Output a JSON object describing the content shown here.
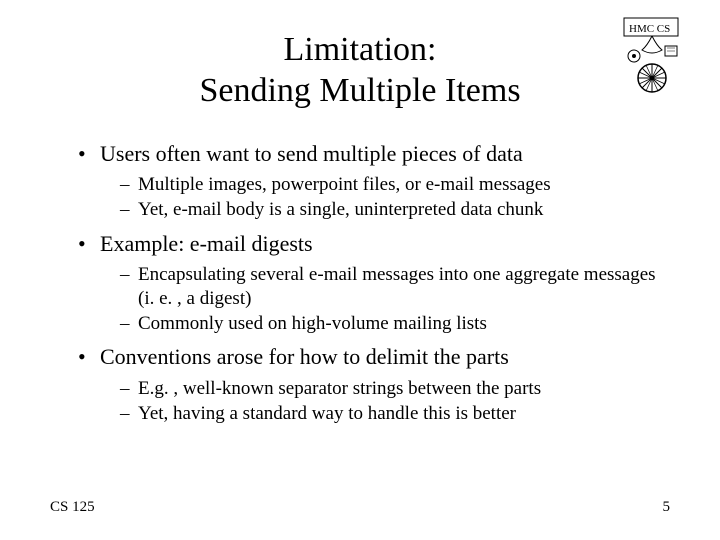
{
  "title_line1": "Limitation:",
  "title_line2": "Sending Multiple Items",
  "bullets": [
    {
      "text": "Users often want to send multiple pieces of data",
      "subs": [
        "Multiple images, powerpoint files, or e-mail messages",
        "Yet, e-mail body is a single, uninterpreted data chunk"
      ]
    },
    {
      "text": "Example: e-mail digests",
      "subs": [
        "Encapsulating several e-mail messages into one aggregate messages (i. e. , a digest)",
        "Commonly used on high-volume mailing lists"
      ]
    },
    {
      "text": "Conventions arose for how to delimit the parts",
      "subs": [
        "E.g. , well-known separator strings between the parts",
        "Yet, having a standard way to handle this is better"
      ]
    }
  ],
  "footer_left": "CS 125",
  "footer_right": "5",
  "logo_label": "HMC CS"
}
